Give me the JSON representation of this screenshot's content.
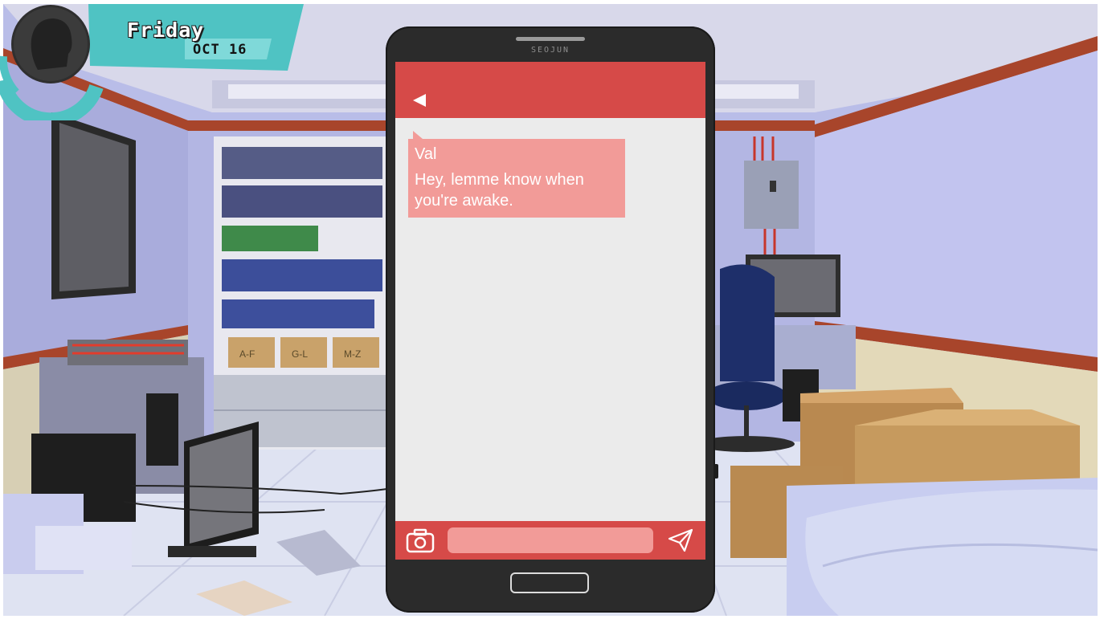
{
  "hud": {
    "day": "Friday",
    "date": "OCT 16",
    "avatar_icon": "head-silhouette-icon",
    "accent_color": "#4fc3c3"
  },
  "scene": {
    "box_labels": [
      "A-F",
      "G-L",
      "M-Z"
    ]
  },
  "phone": {
    "brand": "SEOJUN",
    "header_color": "#d64a48",
    "bubble_color": "#f29b98",
    "back_icon": "back-arrow-icon",
    "camera_icon": "camera-icon",
    "send_icon": "paper-plane-icon",
    "message_input": {
      "value": "",
      "placeholder": ""
    },
    "messages": [
      {
        "sender": "Val",
        "text": "Hey, lemme know when you're awake."
      }
    ]
  }
}
